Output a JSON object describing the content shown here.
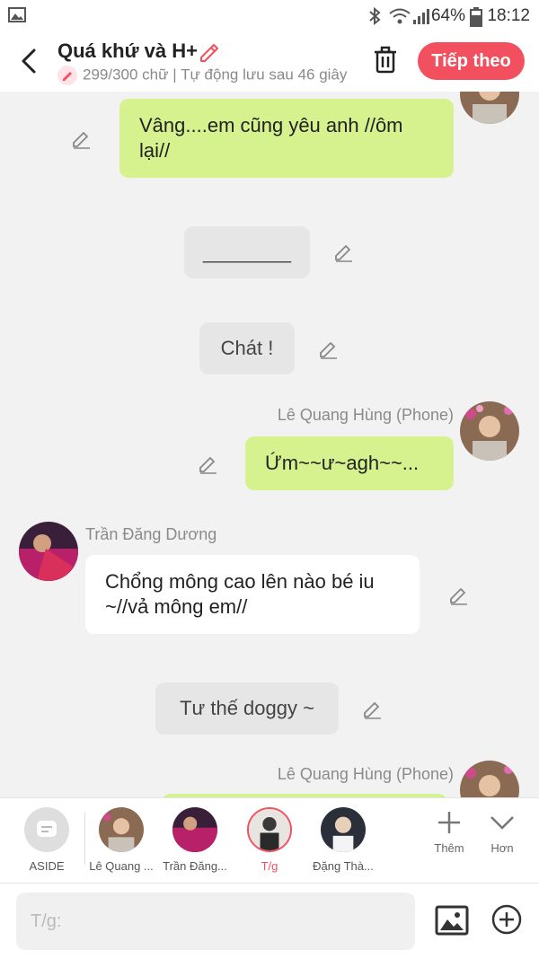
{
  "status_bar": {
    "battery": "64%",
    "time": "18:12"
  },
  "header": {
    "title": "Quá khứ và H+",
    "subtitle": "299/300 chữ | Tự động lưu sau 46 giây",
    "next_label": "Tiếp theo"
  },
  "messages": [
    {
      "type": "right",
      "text": "Vâng....em cũng yêu anh //ôm lại//"
    },
    {
      "type": "narration",
      "text": "________"
    },
    {
      "type": "narration",
      "text": "Chát !"
    },
    {
      "type": "right",
      "name": "Lê Quang Hùng (Phone)",
      "text": "Ứm~~ư~agh~~..."
    },
    {
      "type": "left",
      "name": "Trần Đăng Dương",
      "text": "Chổng mông cao lên nào bé iu ~//vả mông em//"
    },
    {
      "type": "narration",
      "text": "Tư thế doggy ~"
    },
    {
      "type": "right",
      "name": "Lê Quang Hùng (Phone)",
      "text": ""
    }
  ],
  "characters": [
    {
      "label": "ASIDE"
    },
    {
      "label": "Lê Quang ..."
    },
    {
      "label": "Trần Đăng..."
    },
    {
      "label": "T/g"
    },
    {
      "label": "Đặng Thà..."
    }
  ],
  "tools": {
    "more_label": "Thêm",
    "expand_label": "Hơn"
  },
  "input": {
    "placeholder": "T/g:"
  },
  "colors": {
    "accent": "#f2505f",
    "right_bubble": "#d5f28e",
    "left_bubble": "#ffffff",
    "narration_bubble": "#e6e6e6"
  }
}
